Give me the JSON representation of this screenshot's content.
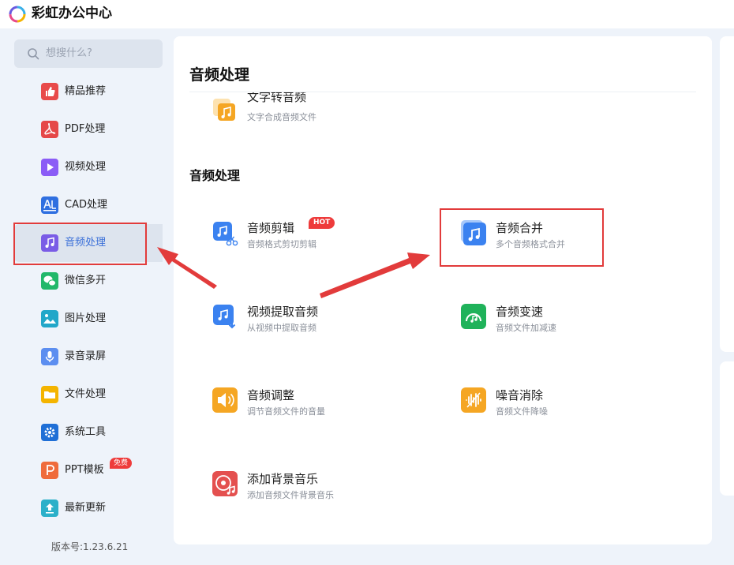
{
  "app": {
    "title": "彩虹办公中心"
  },
  "sidebar": {
    "search_placeholder": "想搜什么?",
    "items": [
      {
        "label": "精品推荐",
        "icon": "thumbs-up-icon",
        "color": "#e84a4a"
      },
      {
        "label": "PDF处理",
        "icon": "pdf-icon",
        "color": "#e54848"
      },
      {
        "label": "视频处理",
        "icon": "play-icon",
        "color": "#8b5cf6"
      },
      {
        "label": "CAD处理",
        "icon": "cad-icon",
        "color": "#2f6fe0"
      },
      {
        "label": "音频处理",
        "icon": "music-icon",
        "color": "#7a5ce6",
        "active": true
      },
      {
        "label": "微信多开",
        "icon": "wechat-icon",
        "color": "#22b86a"
      },
      {
        "label": "图片处理",
        "icon": "image-icon",
        "color": "#22a7c9"
      },
      {
        "label": "录音录屏",
        "icon": "microphone-icon",
        "color": "#5c8ef0"
      },
      {
        "label": "文件处理",
        "icon": "folder-icon",
        "color": "#f4b400"
      },
      {
        "label": "系统工具",
        "icon": "gear-icon",
        "color": "#1f6fd6"
      },
      {
        "label": "PPT模板",
        "icon": "ppt-icon",
        "color": "#ef6b3b",
        "badge": "免费"
      },
      {
        "label": "最新更新",
        "icon": "upload-icon",
        "color": "#2bb0c9"
      }
    ],
    "version": "版本号:1.23.6.21"
  },
  "main": {
    "page_title": "音频处理",
    "partial_tool": {
      "name": "文字转音频",
      "desc": "文字合成音频文件",
      "icon": "text-to-audio-icon"
    },
    "section_title": "音频处理",
    "tools": [
      {
        "name": "音频剪辑",
        "desc": "音频格式剪切剪辑",
        "icon": "audio-cut-icon",
        "badge": "HOT"
      },
      {
        "name": "音频合并",
        "desc": "多个音频格式合并",
        "icon": "audio-merge-icon"
      },
      {
        "name": "视频提取音频",
        "desc": "从视频中提取音频",
        "icon": "video-extract-audio-icon"
      },
      {
        "name": "音频变速",
        "desc": "音频文件加减速",
        "icon": "audio-speed-icon"
      },
      {
        "name": "音频调整",
        "desc": "调节音频文件的音量",
        "icon": "volume-icon"
      },
      {
        "name": "噪音消除",
        "desc": "音频文件降噪",
        "icon": "noise-reduction-icon"
      },
      {
        "name": "添加背景音乐",
        "desc": "添加音频文件背景音乐",
        "icon": "background-music-icon"
      }
    ]
  },
  "colors": {
    "accent": "#3a6fd8",
    "highlight": "#e23b3b",
    "badge_red": "#ee3b3b",
    "blue_icon": "#3b82f0",
    "green_icon": "#1fb25a",
    "orange_icon": "#f5a623",
    "red_icon": "#e4504f"
  }
}
